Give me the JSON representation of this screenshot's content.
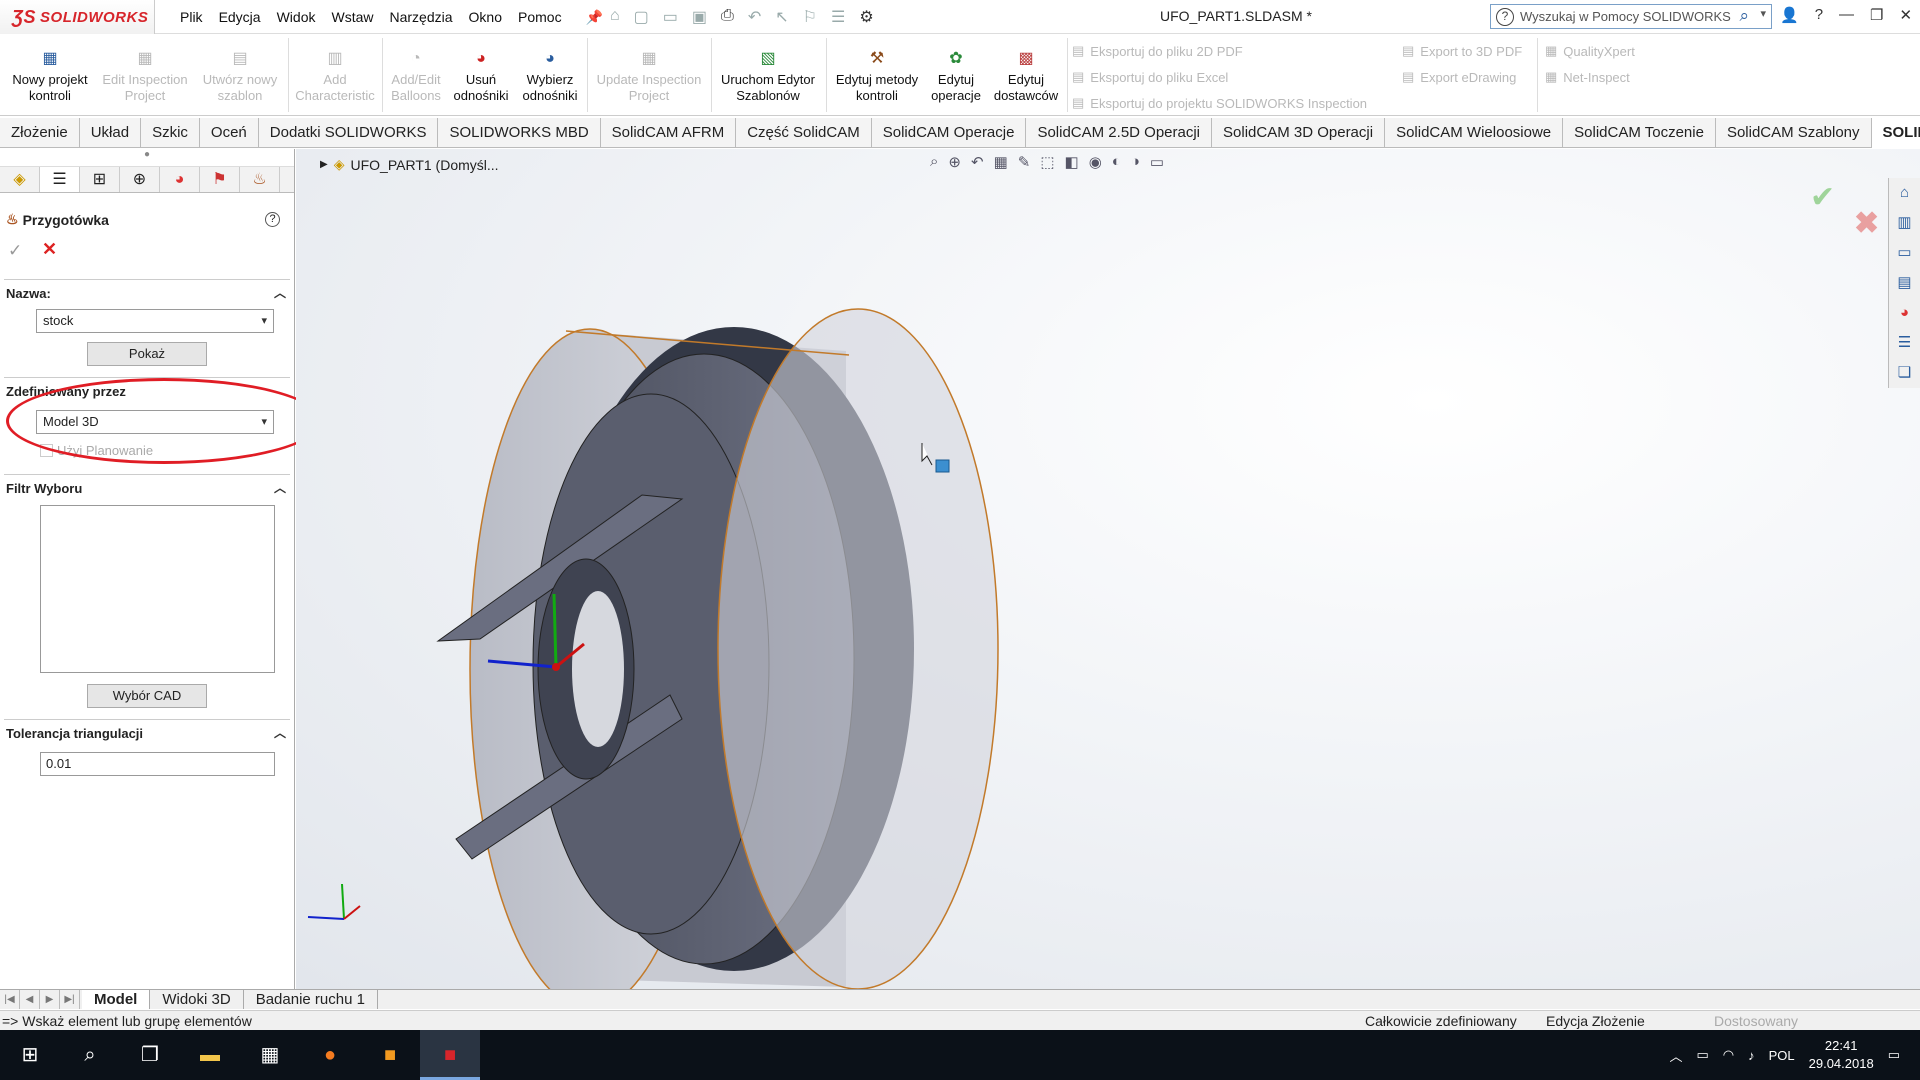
{
  "app": {
    "logo": "SOLIDWORKS",
    "doc_title": "UFO_PART1.SLDASM *"
  },
  "menu": [
    "Plik",
    "Edycja",
    "Widok",
    "Wstaw",
    "Narzędzia",
    "Okno",
    "Pomoc"
  ],
  "search": {
    "placeholder": "Wyszukaj w Pomocy SOLIDWORKS"
  },
  "ribbon": {
    "buttons": [
      {
        "l1": "Nowy projekt",
        "l2": "kontroli",
        "enabled": true
      },
      {
        "l1": "Edit Inspection",
        "l2": "Project",
        "enabled": false
      },
      {
        "l1": "Utwórz nowy",
        "l2": "szablon",
        "enabled": false
      },
      {
        "l1": "Add",
        "l2": "Characteristic",
        "enabled": false
      },
      {
        "l1": "Add/Edit",
        "l2": "Balloons",
        "enabled": false
      },
      {
        "l1": "Usuń",
        "l2": "odnośniki",
        "enabled": true
      },
      {
        "l1": "Wybierz",
        "l2": "odnośniki",
        "enabled": true
      },
      {
        "l1": "Update Inspection",
        "l2": "Project",
        "enabled": false
      },
      {
        "l1": "Uruchom Edytor",
        "l2": "Szablonów",
        "enabled": true
      },
      {
        "l1": "Edytuj metody",
        "l2": "kontroli",
        "enabled": true
      },
      {
        "l1": "Edytuj",
        "l2": "operacje",
        "enabled": true
      },
      {
        "l1": "Edytuj",
        "l2": "dostawców",
        "enabled": true
      }
    ],
    "export1": [
      "Eksportuj do pliku 2D PDF",
      "Eksportuj do pliku Excel",
      "Eksportuj do projektu SOLIDWORKS Inspection"
    ],
    "export2": [
      "Export to 3D PDF",
      "Export eDrawing"
    ],
    "export3": [
      "QualityXpert",
      "Net-Inspect"
    ]
  },
  "tabs": [
    "Złożenie",
    "Układ",
    "Szkic",
    "Oceń",
    "Dodatki SOLIDWORKS",
    "SOLIDWORKS MBD",
    "SolidCAM AFRM",
    "Część SolidCAM",
    "SolidCAM Operacje",
    "SolidCAM 2.5D Operacji",
    "SolidCAM 3D Operacji",
    "SolidCAM Wieloosiowe",
    "SolidCAM Toczenie",
    "SolidCAM Szablony",
    "SOLIDWORKS..."
  ],
  "panel": {
    "title": "Przygotówka",
    "name_label": "Nazwa:",
    "name_value": "stock",
    "show_button": "Pokaż",
    "defined_label": "Zdefiniowany przez",
    "defined_value": "Model 3D",
    "planning": "Użyj Planowanie",
    "filter_label": "Filtr Wyboru",
    "cad_button": "Wybór CAD",
    "tol_label": "Tolerancja triangulacji",
    "tol_value": "0.01"
  },
  "viewport": {
    "tree_item": "UFO_PART1  (Domyśl..."
  },
  "bottom_tabs": [
    "Model",
    "Widoki 3D",
    "Badanie ruchu 1"
  ],
  "status": {
    "left": "=> Wskaż element lub grupę elementów",
    "s1": "Całkowicie zdefiniowany",
    "s2": "Edycja Złożenie",
    "s3": "Dostosowany"
  },
  "taskbar": {
    "lang": "POL",
    "time": "22:41",
    "date": "29.04.2018"
  }
}
